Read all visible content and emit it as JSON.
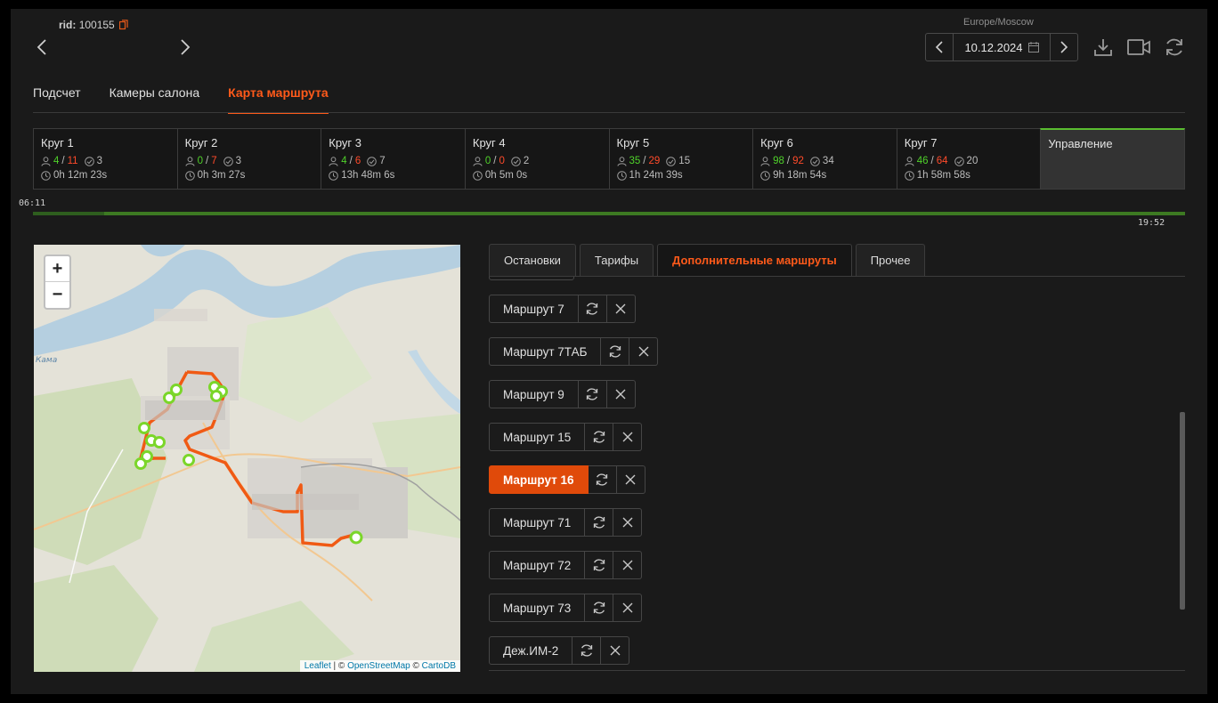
{
  "header": {
    "rid_label": "rid:",
    "rid_value": "100155",
    "timezone": "Europe/Moscow",
    "date": "10.12.2024"
  },
  "main_tabs": [
    {
      "label": "Подсчет",
      "active": false
    },
    {
      "label": "Камеры салона",
      "active": false
    },
    {
      "label": "Карта маршрута",
      "active": true
    }
  ],
  "laps": [
    {
      "name": "Круг 1",
      "in": "4",
      "out": "11",
      "stops": "3",
      "time": "0h 12m 23s"
    },
    {
      "name": "Круг 2",
      "in": "0",
      "out": "7",
      "stops": "3",
      "time": "0h 3m 27s"
    },
    {
      "name": "Круг 3",
      "in": "4",
      "out": "6",
      "stops": "7",
      "time": "13h 48m 6s"
    },
    {
      "name": "Круг 4",
      "in": "0",
      "out": "0",
      "stops": "2",
      "time": "0h 5m 0s"
    },
    {
      "name": "Круг 5",
      "in": "35",
      "out": "29",
      "stops": "15",
      "time": "1h 24m 39s"
    },
    {
      "name": "Круг 6",
      "in": "98",
      "out": "92",
      "stops": "34",
      "time": "9h 18m 54s"
    },
    {
      "name": "Круг 7",
      "in": "46",
      "out": "64",
      "stops": "20",
      "time": "1h 58m 58s"
    }
  ],
  "control_label": "Управление",
  "timeline": {
    "start": "06:11",
    "end": "19:52"
  },
  "map": {
    "zoom_in": "+",
    "zoom_out": "−",
    "river_label": "Кама",
    "attribution": {
      "leaflet": "Leaflet",
      "osm": "OpenStreetMap",
      "carto": "CartoDB",
      "sep1": " | © ",
      "sep2": " © "
    }
  },
  "sub_tabs": [
    {
      "label": "Остановки",
      "active": false
    },
    {
      "label": "Тарифы",
      "active": false
    },
    {
      "label": "Дополнительные маршруты",
      "active": true
    },
    {
      "label": "Прочее",
      "active": false
    }
  ],
  "routes": [
    {
      "label": "Маршрут 7",
      "active": false
    },
    {
      "label": "Маршрут 7ТАБ",
      "active": false
    },
    {
      "label": "Маршрут 9",
      "active": false
    },
    {
      "label": "Маршрут 15",
      "active": false
    },
    {
      "label": "Маршрут 16",
      "active": true
    },
    {
      "label": "Маршрут 71",
      "active": false
    },
    {
      "label": "Маршрут 72",
      "active": false
    },
    {
      "label": "Маршрут 73",
      "active": false
    },
    {
      "label": "Деж.ИМ-2",
      "active": false
    }
  ],
  "colors": {
    "accent": "#ff5a1a",
    "in_count": "#4fd12a",
    "out_count": "#ff4a2a",
    "route_line": "#f05a14",
    "stop_marker": "#7bd62a"
  }
}
